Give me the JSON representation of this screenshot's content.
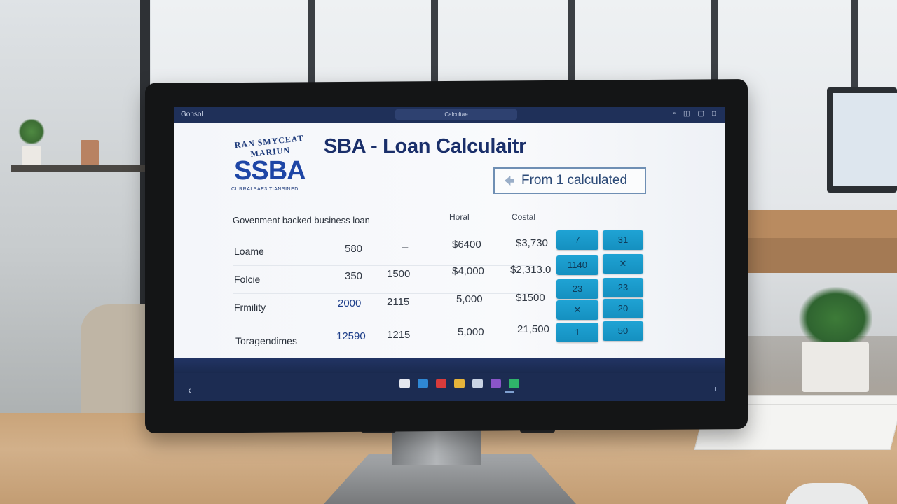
{
  "window": {
    "app_label": "Gonsol",
    "tab_label": "Calcultae",
    "controls": [
      "▫",
      "◫",
      "▢",
      "□"
    ]
  },
  "logo": {
    "arc_text": "RAN SMYCEAT MARIUN",
    "mark": "SSBA",
    "subtext": "CURRALSAE3 TIANSINED"
  },
  "header": {
    "title": "SBA - Loan Calculaitr",
    "calc_button_label": "From 1 calculated",
    "calc_button_icon": "arrow-icon"
  },
  "table": {
    "section_label": "Govenment backed business loan",
    "column_headers": [
      "Horal",
      "Costal"
    ],
    "rows": [
      {
        "label": "Loame",
        "c1": "580",
        "c2": "–",
        "c3": "$6400",
        "c4": "$3,730"
      },
      {
        "label": "Folcie",
        "c1": "350",
        "c2": "1500",
        "c3": "$4,000",
        "c4": "$2,313.0"
      },
      {
        "label": "Frmility",
        "c1": "2000",
        "c2": "2115",
        "c3": "5,000",
        "c4": "$1500"
      },
      {
        "label": "Toragendimes",
        "c1": "12590",
        "c2": "1215",
        "c3": "5,000",
        "c4": "21,500"
      }
    ]
  },
  "keypad": {
    "accent_color": "#1fa3d4",
    "keys": [
      [
        "7",
        "31"
      ],
      [
        "1140",
        "✕"
      ],
      [
        "23",
        "23"
      ],
      [
        "✕",
        "20"
      ],
      [
        "1",
        "50"
      ]
    ]
  },
  "taskbar": {
    "back_label": "‹",
    "icon_colors": [
      "#e5e8ef",
      "#2f88d4",
      "#d83b3b",
      "#e6b43a",
      "#c9d4e4",
      "#8a55c9",
      "#2fb36a"
    ]
  }
}
